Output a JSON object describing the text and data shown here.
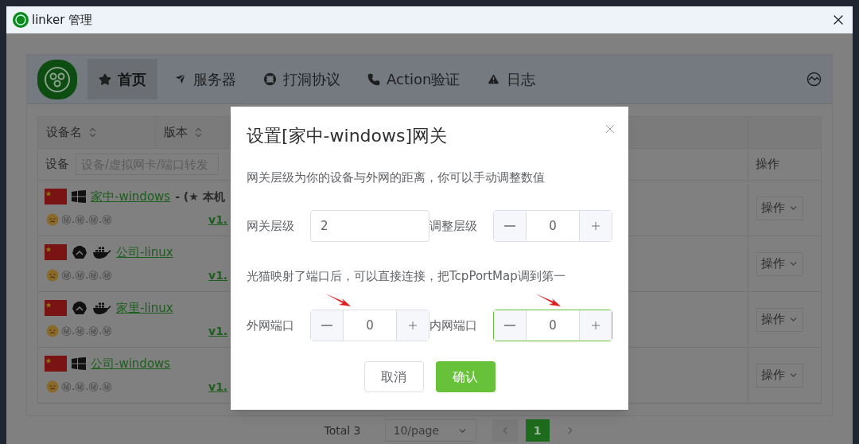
{
  "window": {
    "title": "linker 管理"
  },
  "nav": {
    "tabs": [
      {
        "label": "首页",
        "selected": true
      },
      {
        "label": "服务器",
        "selected": false
      },
      {
        "label": "打洞协议",
        "selected": false
      },
      {
        "label": "Action验证",
        "selected": false
      },
      {
        "label": "日志",
        "selected": false
      }
    ]
  },
  "table": {
    "columns": [
      {
        "label": "设备名"
      },
      {
        "label": "版本"
      }
    ],
    "filter": {
      "label": "设备",
      "placeholder": "设备/虚拟网卡/端口转发"
    },
    "action_column": "操作",
    "rows": [
      {
        "name": "家中-windows",
        "note": "- (★ 本机",
        "kind": "windows",
        "docker": false,
        "ip": "㊙.㊙.㊙.㊙",
        "version": "v1.",
        "action": "操作"
      },
      {
        "name": "公司-linux",
        "kind": "linux",
        "docker": true,
        "ip": "㊙.㊙.㊙.㊙",
        "version": "v1.",
        "action": "操作"
      },
      {
        "name": "家里-linux",
        "kind": "linux",
        "docker": true,
        "ip": "㊙.㊙.㊙.㊙",
        "version": "v1.",
        "action": "操作"
      },
      {
        "name": "公司-windows",
        "kind": "windows",
        "docker": false,
        "ip": "㊙.㊙.㊙.㊙",
        "version": "v1.",
        "action": "操作"
      }
    ]
  },
  "pagination": {
    "total": "Total 3",
    "page_size": "10/page",
    "pages": [
      {
        "label": "1",
        "selected": true
      }
    ]
  },
  "dialog": {
    "title": "设置[家中-windows]网关",
    "description": "网关层级为你的设备与外网的距离，你可以手动调整数值",
    "level_fields": [
      {
        "kind": "input",
        "label": "网关层级",
        "value": "2"
      },
      {
        "kind": "stepper",
        "label": "调整层级",
        "value": "0",
        "focused": false
      }
    ],
    "hint": "光猫映射了端口后，可以直接连接，把TcpPortMap调到第一",
    "port_fields": [
      {
        "kind": "stepper",
        "label": "外网端口",
        "value": "0",
        "focused": false
      },
      {
        "kind": "stepper",
        "label": "内网端口",
        "value": "0",
        "focused": true
      }
    ],
    "buttons": [
      {
        "label": "取消",
        "primary": false
      },
      {
        "label": "确认",
        "primary": true
      }
    ]
  }
}
